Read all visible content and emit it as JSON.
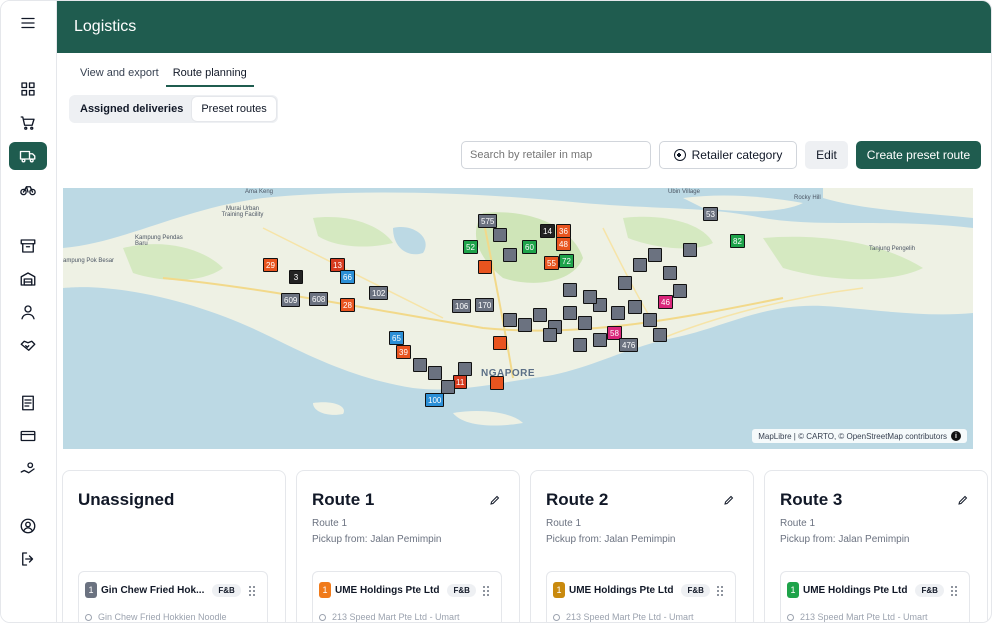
{
  "app": {
    "title": "Logistics"
  },
  "sidebar": {
    "items": [
      {
        "icon": "menu-icon"
      },
      {
        "icon": "dashboard-icon"
      },
      {
        "icon": "cart-icon"
      },
      {
        "icon": "truck-icon",
        "active": true
      },
      {
        "icon": "bicycle-icon"
      },
      {
        "icon": "archive-icon"
      },
      {
        "icon": "warehouse-icon"
      },
      {
        "icon": "user-icon"
      },
      {
        "icon": "handshake-icon"
      },
      {
        "icon": "document-icon"
      },
      {
        "icon": "credit-card-icon"
      },
      {
        "icon": "hand-coins-icon"
      },
      {
        "icon": "account-icon"
      },
      {
        "icon": "logout-icon"
      }
    ]
  },
  "tabs": [
    {
      "label": "View and export",
      "active": false
    },
    {
      "label": "Route planning",
      "active": true
    }
  ],
  "subtabs": [
    {
      "label": "Assigned deliveries",
      "active": false
    },
    {
      "label": "Preset routes",
      "active": true
    }
  ],
  "toolbar": {
    "search_placeholder": "Search by retailer in map",
    "category_label": "Retailer category",
    "edit_label": "Edit",
    "create_label": "Create preset route"
  },
  "map": {
    "places": [
      "Ama Keng",
      "Murai Urban Training Facility",
      "Kampung Pendas Baru",
      "ampung Pok Besar",
      "Ubin Village",
      "Rocky Hill",
      "Tanjung Pengelih"
    ],
    "city_label": "NGAPORE",
    "attribution": "MapLibre | © CARTO, © OpenStreetMap contributors",
    "markers": [
      "29",
      "3",
      "13",
      "66",
      "609",
      "608",
      "28",
      "102",
      "65",
      "39",
      "52",
      "575",
      "14",
      "36",
      "48",
      "60",
      "55",
      "72",
      "106",
      "170",
      "62",
      "82",
      "53",
      "58",
      "476",
      "46",
      "11",
      "100"
    ]
  },
  "colors": {
    "brand": "#1f5c4f",
    "marker_orange": "#e8541f",
    "marker_red": "#d63b1f",
    "marker_green": "#1ea34a",
    "marker_blue": "#2b8fd6",
    "marker_gray": "#6b7280",
    "marker_pink": "#d9267a",
    "marker_dark": "#222222"
  },
  "cards": [
    {
      "title": "Unassigned",
      "has_edit": false,
      "item": {
        "num": "1",
        "num_color": "#6b7280",
        "name": "Gin Chew Fried Hok...",
        "tag": "F&B",
        "address": "Gin Chew Fried Hokkien Noodle"
      }
    },
    {
      "title": "Route 1",
      "sub": "Route 1",
      "pickup": "Pickup from: Jalan Pemimpin",
      "has_edit": true,
      "item": {
        "num": "1",
        "num_color": "#f07a1a",
        "name": "UME Holdings Pte Ltd",
        "tag": "F&B",
        "address": "213 Speed Mart Pte Ltd - Umart"
      }
    },
    {
      "title": "Route 2",
      "sub": "Route 1",
      "pickup": "Pickup from: Jalan Pemimpin",
      "has_edit": true,
      "item": {
        "num": "1",
        "num_color": "#c98a0e",
        "name": "UME Holdings Pte Ltd",
        "tag": "F&B",
        "address": "213 Speed Mart Pte Ltd - Umart"
      }
    },
    {
      "title": "Route 3",
      "sub": "Route 1",
      "pickup": "Pickup from: Jalan Pemimpin",
      "has_edit": true,
      "item": {
        "num": "1",
        "num_color": "#1ea34a",
        "name": "UME Holdings Pte Ltd",
        "tag": "F&B",
        "address": "213 Speed Mart Pte Ltd - Umart"
      }
    }
  ]
}
